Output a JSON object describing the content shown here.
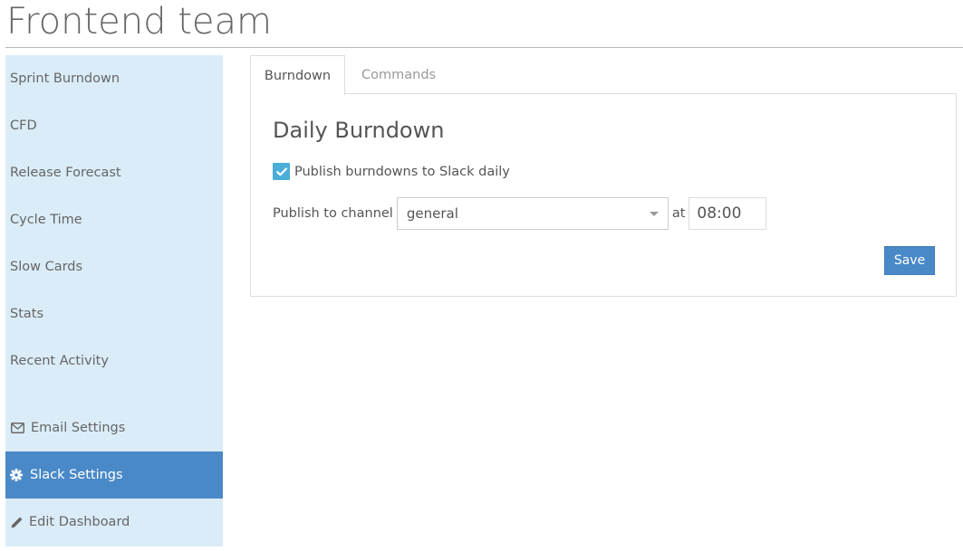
{
  "header": {
    "title": "Frontend team"
  },
  "sidebar": {
    "items": [
      {
        "label": "Sprint Burndown",
        "icon": null
      },
      {
        "label": "CFD",
        "icon": null
      },
      {
        "label": "Release Forecast",
        "icon": null
      },
      {
        "label": "Cycle Time",
        "icon": null
      },
      {
        "label": "Slow Cards",
        "icon": null
      },
      {
        "label": "Stats",
        "icon": null
      },
      {
        "label": "Recent Activity",
        "icon": null
      }
    ],
    "settings": [
      {
        "label": "Email Settings",
        "icon": "envelope-icon",
        "active": false
      },
      {
        "label": "Slack Settings",
        "icon": "gear-icon",
        "active": true
      },
      {
        "label": "Edit Dashboard",
        "icon": "pencil-icon",
        "active": false
      }
    ]
  },
  "tabs": [
    {
      "label": "Burndown",
      "active": true
    },
    {
      "label": "Commands",
      "active": false
    }
  ],
  "panel": {
    "heading": "Daily Burndown",
    "checkbox_label": "Publish burndowns to Slack daily",
    "checkbox_checked": true,
    "channel_label": "Publish to channel",
    "channel_value": "general",
    "at_label": "at",
    "time_value": "08:00",
    "save_label": "Save"
  },
  "colors": {
    "accent": "#4a89c8",
    "sidebar_bg": "#daecf7",
    "checkbox": "#4aaed9"
  }
}
